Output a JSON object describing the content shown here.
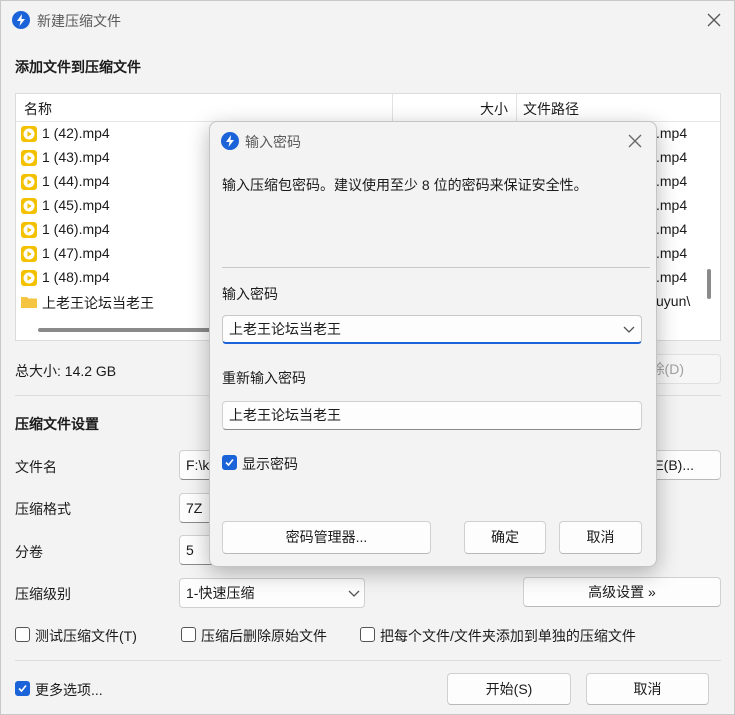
{
  "main": {
    "title": "新建压缩文件",
    "heading_add": "添加文件到压缩文件",
    "columns": {
      "name": "名称",
      "size": "大小",
      "path": "文件路径"
    },
    "files": [
      {
        "name": "1 (42).mp4",
        "path": ".mp4",
        "type": "video"
      },
      {
        "name": "1 (43).mp4",
        "path": ".mp4",
        "type": "video"
      },
      {
        "name": "1 (44).mp4",
        "path": ".mp4",
        "type": "video"
      },
      {
        "name": "1 (45).mp4",
        "path": ".mp4",
        "type": "video"
      },
      {
        "name": "1 (46).mp4",
        "path": ".mp4",
        "type": "video"
      },
      {
        "name": "1 (47).mp4",
        "path": ".mp4",
        "type": "video"
      },
      {
        "name": "1 (48).mp4",
        "path": ".mp4",
        "type": "video"
      },
      {
        "name": "上老王论坛当老王",
        "path": "uyun\\",
        "type": "folder"
      }
    ],
    "total_size": "总大小: 14.2 GB",
    "delete_button": "除(D)",
    "heading_settings": "压缩文件设置",
    "filename_label": "文件名",
    "filename_value": "F:\\k",
    "browse_button": "E(B)...",
    "format_label": "压缩格式",
    "format_value": "7Z",
    "split_label": "分卷",
    "split_value": "5",
    "level_label": "压缩级别",
    "level_value": "1-快速压缩",
    "advanced_button": "高级设置 »",
    "opt_test": "测试压缩文件(T)",
    "opt_delete": "压缩后删除原始文件",
    "opt_separate": "把每个文件/文件夹添加到单独的压缩文件",
    "more_options": "更多选项...",
    "start_button": "开始(S)",
    "cancel_button": "取消"
  },
  "dialog": {
    "title": "输入密码",
    "description": "输入压缩包密码。建议使用至少 8 位的密码来保证安全性。",
    "pwd_label": "输入密码",
    "pwd_value": "上老王论坛当老王",
    "repeat_label": "重新输入密码",
    "repeat_value": "上老王论坛当老王",
    "show_password": "显示密码",
    "manager_button": "密码管理器...",
    "ok_button": "确定",
    "cancel_button": "取消"
  },
  "colors": {
    "accent": "#1a63d8",
    "video_icon": "#f2c200",
    "folder_icon": "#f5c542"
  }
}
